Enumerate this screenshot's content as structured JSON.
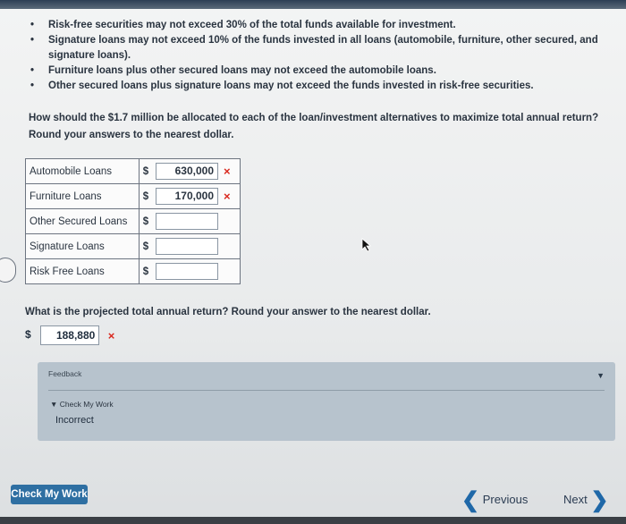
{
  "bullets": [
    "Risk-free securities may not exceed 30% of the total funds available for investment.",
    "Signature loans may not exceed 10% of the funds invested in all loans (automobile, furniture, other secured, and signature loans).",
    "Furniture loans plus other secured loans may not exceed the automobile loans.",
    "Other secured loans plus signature loans may not exceed the funds invested in risk-free securities."
  ],
  "bullet_glyph": "•",
  "question": "How should the $1.7 million be allocated to each of the loan/investment alternatives to maximize total annual return? Round your answers to the nearest dollar.",
  "allocation": {
    "currency": "$",
    "rows": [
      {
        "label": "Automobile Loans",
        "value": "630,000",
        "mark": "×"
      },
      {
        "label": "Furniture Loans",
        "value": "170,000",
        "mark": "×"
      },
      {
        "label": "Other Secured Loans",
        "value": "",
        "mark": ""
      },
      {
        "label": "Signature Loans",
        "value": "",
        "mark": ""
      },
      {
        "label": "Risk Free Loans",
        "value": "",
        "mark": ""
      }
    ]
  },
  "question2": "What is the projected total annual return? Round your answer to the nearest dollar.",
  "total": {
    "currency": "$",
    "value": "188,880",
    "mark": "×"
  },
  "feedback": {
    "title": "Feedback",
    "check_label": "Check My Work",
    "result": "Incorrect",
    "collapse_icon": "▼",
    "expand_icon": "▼"
  },
  "buttons": {
    "check_my_work": "Check My Work",
    "previous": "Previous",
    "next": "Next",
    "previous_icon": "❮",
    "next_icon": "❯"
  },
  "colors": {
    "error_red": "#d9281e",
    "button_blue": "#2e6fa2",
    "chevron_blue": "#1f68a8"
  }
}
